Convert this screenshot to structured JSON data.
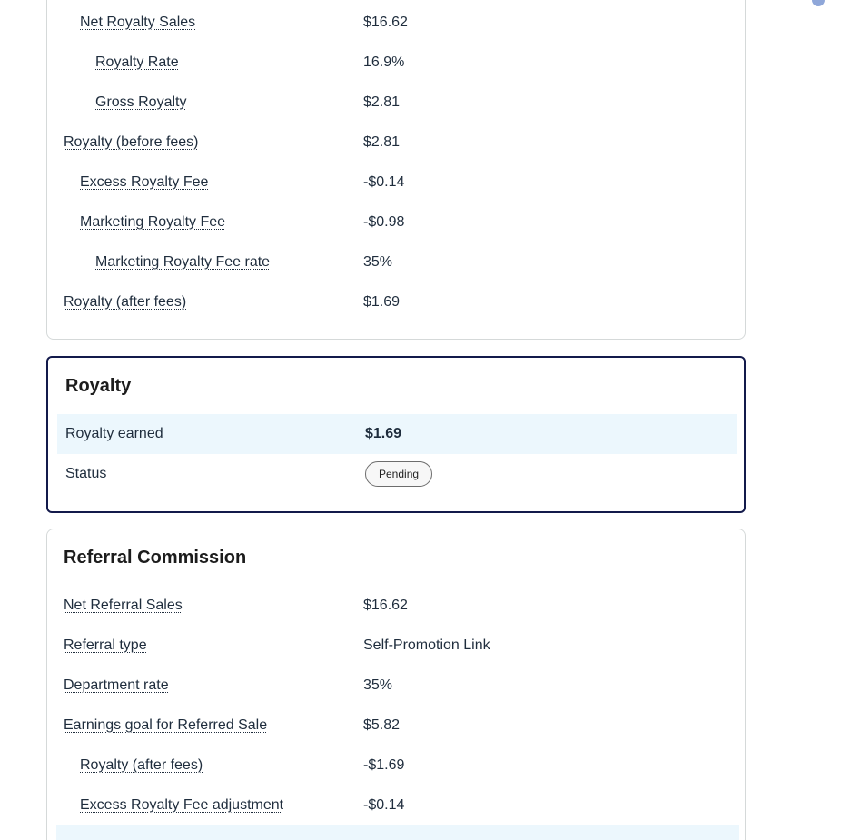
{
  "royalty_breakdown": {
    "rows": [
      {
        "label": "Net Royalty Sales",
        "value": "$16.62"
      },
      {
        "label": "Royalty Rate",
        "value": "16.9%"
      },
      {
        "label": "Gross Royalty",
        "value": "$2.81"
      },
      {
        "label": "Royalty (before fees)",
        "value": "$2.81"
      },
      {
        "label": "Excess Royalty Fee",
        "value": "-$0.14"
      },
      {
        "label": "Marketing Royalty Fee",
        "value": "-$0.98"
      },
      {
        "label": "Marketing Royalty Fee rate",
        "value": "35%"
      },
      {
        "label": "Royalty (after fees)",
        "value": "$1.69"
      }
    ]
  },
  "royalty_summary": {
    "title": "Royalty",
    "earned_label": "Royalty earned",
    "earned_value": "$1.69",
    "status_label": "Status",
    "status_value": "Pending"
  },
  "referral": {
    "title": "Referral Commission",
    "rows": [
      {
        "label": "Net Referral Sales",
        "value": "$16.62"
      },
      {
        "label": "Referral type",
        "value": "Self-Promotion Link"
      },
      {
        "label": "Department rate",
        "value": "35%"
      },
      {
        "label": "Earnings goal for Referred Sale",
        "value": "$5.82"
      },
      {
        "label": "Royalty (after fees)",
        "value": "-$1.69"
      },
      {
        "label": "Excess Royalty Fee adjustment",
        "value": "-$0.14"
      }
    ]
  }
}
